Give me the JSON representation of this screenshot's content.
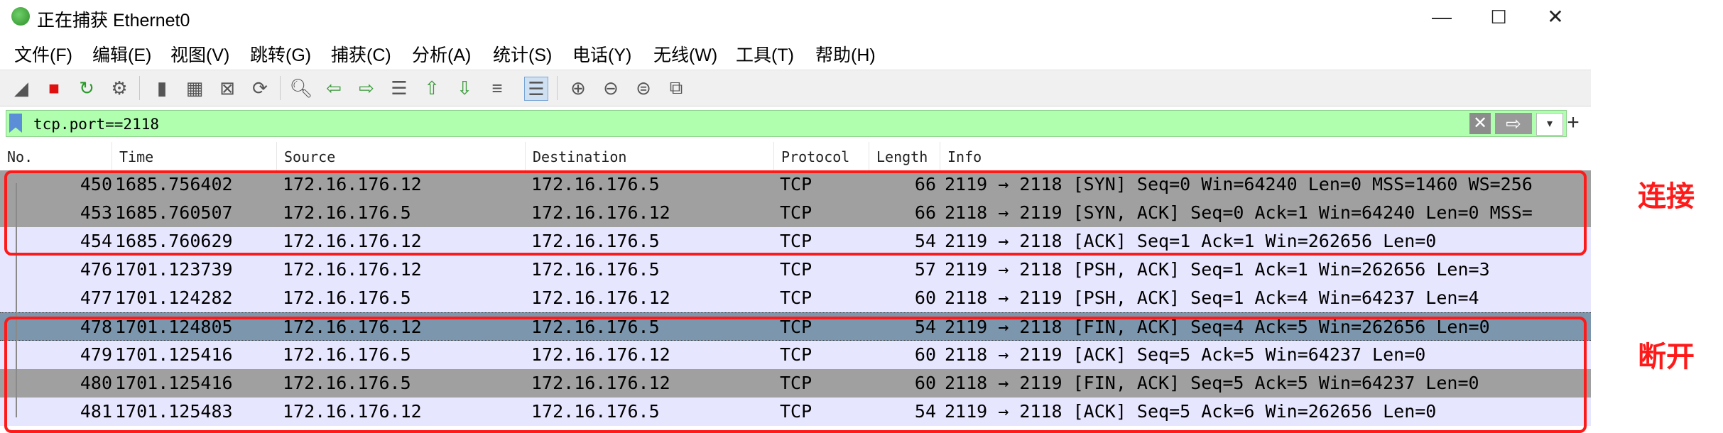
{
  "window": {
    "title": "正在捕获 Ethernet0",
    "controls": {
      "minimize": "—",
      "maximize": "☐",
      "close": "✕"
    }
  },
  "menu": [
    {
      "label": "文件(F)"
    },
    {
      "label": "编辑(E)"
    },
    {
      "label": "视图(V)"
    },
    {
      "label": "跳转(G)"
    },
    {
      "label": "捕获(C)"
    },
    {
      "label": "分析(A)"
    },
    {
      "label": "统计(S)"
    },
    {
      "label": "电话(Y)"
    },
    {
      "label": "无线(W)"
    },
    {
      "label": "工具(T)"
    },
    {
      "label": "帮助(H)"
    }
  ],
  "toolbar": [
    {
      "icon": "shark-fin-start-icon",
      "glyph": "◢"
    },
    {
      "icon": "stop-capture-icon",
      "glyph": "■",
      "color": "#e01010"
    },
    {
      "icon": "restart-capture-icon",
      "glyph": "↻",
      "color": "#2a9a2a"
    },
    {
      "icon": "capture-options-icon",
      "glyph": "⚙"
    },
    {
      "icon": "open-file-icon",
      "glyph": "▮"
    },
    {
      "icon": "save-file-icon",
      "glyph": "▦"
    },
    {
      "icon": "close-file-icon",
      "glyph": "⊠"
    },
    {
      "icon": "reload-file-icon",
      "glyph": "⟳"
    },
    {
      "icon": "find-packet-icon",
      "glyph": "🔍︎"
    },
    {
      "icon": "go-back-icon",
      "glyph": "⇦",
      "color": "#3a9a3a"
    },
    {
      "icon": "go-forward-icon",
      "glyph": "⇨",
      "color": "#3a9a3a"
    },
    {
      "icon": "go-to-packet-icon",
      "glyph": "☰"
    },
    {
      "icon": "first-packet-icon",
      "glyph": "⇧",
      "color": "#3a9a3a"
    },
    {
      "icon": "last-packet-icon",
      "glyph": "⇩",
      "color": "#3a9a3a"
    },
    {
      "icon": "auto-scroll-icon",
      "glyph": "≡"
    },
    {
      "icon": "colorize-icon",
      "glyph": "☰"
    },
    {
      "icon": "zoom-in-icon",
      "glyph": "⊕"
    },
    {
      "icon": "zoom-out-icon",
      "glyph": "⊖"
    },
    {
      "icon": "zoom-normal-icon",
      "glyph": "⊜"
    },
    {
      "icon": "resize-columns-icon",
      "glyph": "⧉"
    }
  ],
  "filter": {
    "value": "tcp.port==2118",
    "clear_glyph": "✕",
    "apply_glyph": "⇨",
    "dropdown_glyph": "▾",
    "add_glyph": "+"
  },
  "columns": [
    {
      "label": "No."
    },
    {
      "label": "Time"
    },
    {
      "label": "Source"
    },
    {
      "label": "Destination"
    },
    {
      "label": "Protocol"
    },
    {
      "label": "Length"
    },
    {
      "label": "Info"
    }
  ],
  "packets": [
    {
      "no": "450",
      "time": "1685.756402",
      "src": "172.16.176.12",
      "dst": "172.16.176.5",
      "proto": "TCP",
      "len": "66",
      "info": "2119 → 2118 [SYN] Seq=0 Win=64240 Len=0 MSS=1460 WS=256",
      "bg": "#a0a0a0"
    },
    {
      "no": "453",
      "time": "1685.760507",
      "src": "172.16.176.5",
      "dst": "172.16.176.12",
      "proto": "TCP",
      "len": "66",
      "info": "2118 → 2119 [SYN, ACK] Seq=0 Ack=1 Win=64240 Len=0 MSS=",
      "bg": "#a0a0a0"
    },
    {
      "no": "454",
      "time": "1685.760629",
      "src": "172.16.176.12",
      "dst": "172.16.176.5",
      "proto": "TCP",
      "len": "54",
      "info": "2119 → 2118 [ACK] Seq=1 Ack=1 Win=262656 Len=0",
      "bg": "#e7e6ff"
    },
    {
      "no": "476",
      "time": "1701.123739",
      "src": "172.16.176.12",
      "dst": "172.16.176.5",
      "proto": "TCP",
      "len": "57",
      "info": "2119 → 2118 [PSH, ACK] Seq=1 Ack=1 Win=262656 Len=3",
      "bg": "#e7e6ff"
    },
    {
      "no": "477",
      "time": "1701.124282",
      "src": "172.16.176.5",
      "dst": "172.16.176.12",
      "proto": "TCP",
      "len": "60",
      "info": "2118 → 2119 [PSH, ACK] Seq=1 Ack=4 Win=64237 Len=4",
      "bg": "#e7e6ff"
    },
    {
      "no": "478",
      "time": "1701.124805",
      "src": "172.16.176.12",
      "dst": "172.16.176.5",
      "proto": "TCP",
      "len": "54",
      "info": "2119 → 2118 [FIN, ACK] Seq=4 Ack=5 Win=262656 Len=0",
      "bg": "#7b96ad",
      "selected": true
    },
    {
      "no": "479",
      "time": "1701.125416",
      "src": "172.16.176.5",
      "dst": "172.16.176.12",
      "proto": "TCP",
      "len": "60",
      "info": "2118 → 2119 [ACK] Seq=5 Ack=5 Win=64237 Len=0",
      "bg": "#e7e6ff"
    },
    {
      "no": "480",
      "time": "1701.125416",
      "src": "172.16.176.5",
      "dst": "172.16.176.12",
      "proto": "TCP",
      "len": "60",
      "info": "2118 → 2119 [FIN, ACK] Seq=5 Ack=5 Win=64237 Len=0",
      "bg": "#a0a0a0"
    },
    {
      "no": "481",
      "time": "1701.125483",
      "src": "172.16.176.12",
      "dst": "172.16.176.5",
      "proto": "TCP",
      "len": "54",
      "info": "2119 → 2118 [ACK] Seq=5 Ack=6 Win=262656 Len=0",
      "bg": "#e7e6ff"
    }
  ],
  "annotations": {
    "connect": "连接",
    "disconnect": "断开",
    "color": "#ff1a1a"
  }
}
